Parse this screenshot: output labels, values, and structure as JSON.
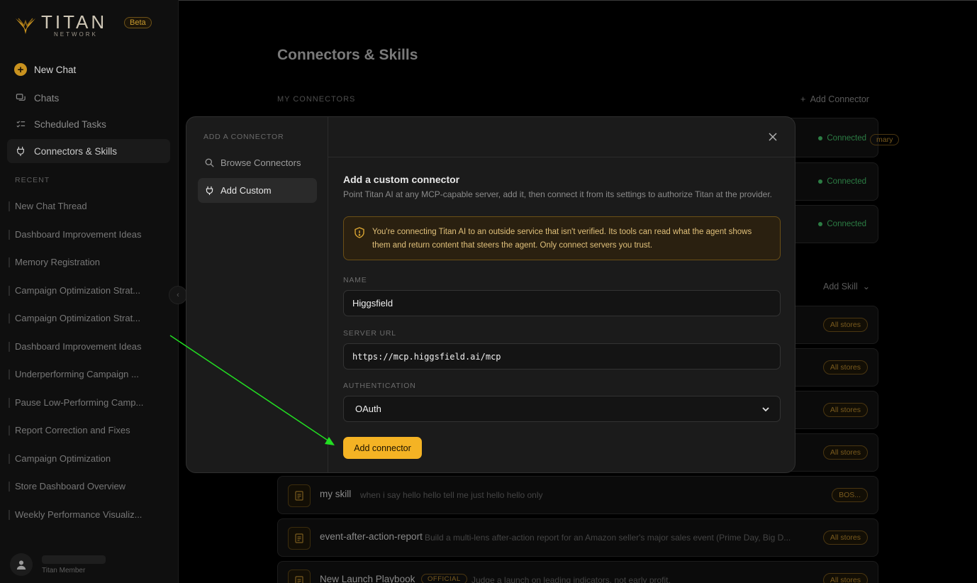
{
  "brand": {
    "name": "TITAN",
    "sub": "NETWORK",
    "badge": "Beta"
  },
  "nav": {
    "new_chat": "New Chat",
    "chats": "Chats",
    "scheduled": "Scheduled Tasks",
    "connectors": "Connectors & Skills"
  },
  "recent": {
    "label": "RECENT",
    "items": [
      "New Chat Thread",
      "Dashboard Improvement Ideas",
      "Memory Registration",
      "Campaign Optimization Strat...",
      "Campaign Optimization Strat...",
      "Dashboard Improvement Ideas",
      "Underperforming Campaign ...",
      "Pause Low-Performing Camp...",
      "Report Correction and Fixes",
      "Campaign Optimization",
      "Store Dashboard Overview",
      "Weekly Performance Visualiz..."
    ]
  },
  "user": {
    "role": "Titan Member"
  },
  "page": {
    "title": "Connectors & Skills",
    "my_connectors_label": "MY CONNECTORS",
    "add_connector": "Add Connector",
    "add_skill": "Add Skill",
    "primary_chip": "mary",
    "connected": "Connected"
  },
  "skills": [
    {
      "name": "",
      "desc": "",
      "store": "All stores"
    },
    {
      "name": "",
      "desc": "",
      "store": "All stores"
    },
    {
      "name": "",
      "desc": "",
      "store": "All stores"
    },
    {
      "name": "",
      "desc": "",
      "store": "All stores"
    },
    {
      "name": "my skill",
      "desc": "when i say hello hello tell me just hello hello only",
      "store": "BOS..."
    },
    {
      "name": "event-after-action-report",
      "desc": "Build a multi-lens after-action report for an Amazon seller's major sales event (Prime Day, Big D...",
      "store": "All stores"
    },
    {
      "name": "New Launch Playbook",
      "badge": "OFFICIAL",
      "desc": "Judge a launch on leading indicators, not early profit.",
      "store": "All stores"
    }
  ],
  "modal": {
    "section_label": "ADD A CONNECTOR",
    "tab_browse": "Browse Connectors",
    "tab_custom": "Add Custom",
    "title": "Add a custom connector",
    "subtitle": "Point Titan AI at any MCP-capable server, add it, then connect it from its settings to authorize Titan at the provider.",
    "warning": "You're connecting Titan AI to an outside service that isn't verified. Its tools can read what the agent shows them and return content that steers the agent. Only connect servers you trust.",
    "name_label": "NAME",
    "name_value": "Higgsfield",
    "url_label": "SERVER URL",
    "url_value": "https://mcp.higgsfield.ai/mcp",
    "auth_label": "AUTHENTICATION",
    "auth_value": "OAuth",
    "submit": "Add connector"
  },
  "colors": {
    "accent": "#f4b324",
    "connected": "#2c7d44",
    "warning_bg": "#2a2010",
    "annotation_arrow": "#22dd22"
  }
}
